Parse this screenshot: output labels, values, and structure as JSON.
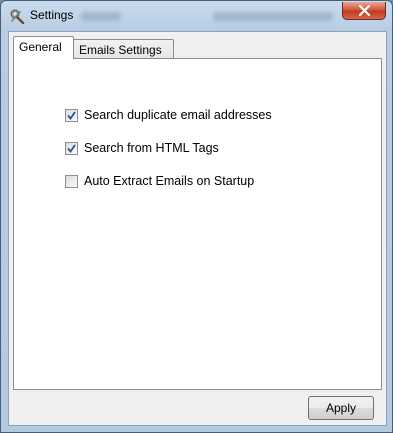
{
  "window": {
    "title": "Settings",
    "close_icon": "close-icon",
    "app_icon": "settings-tools-icon"
  },
  "tabs": [
    {
      "label": "General",
      "selected": true
    },
    {
      "label": "Emails Settings",
      "selected": false
    }
  ],
  "general": {
    "options": [
      {
        "label": "Search duplicate email addresses",
        "checked": true
      },
      {
        "label": "Search from HTML Tags",
        "checked": true
      },
      {
        "label": "Auto Extract Emails on Startup",
        "checked": false
      }
    ]
  },
  "footer": {
    "apply_label": "Apply"
  },
  "colors": {
    "close_button": "#c9432a",
    "titlebar": "#b9cfe5",
    "panel_background": "#ffffff"
  }
}
